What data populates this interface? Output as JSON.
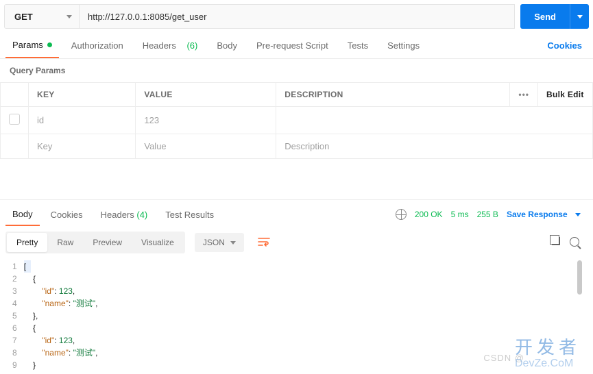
{
  "request": {
    "method": "GET",
    "url": "http://127.0.0.1:8085/get_user",
    "send_label": "Send"
  },
  "tabs": {
    "params": "Params",
    "auth": "Authorization",
    "headers": "Headers",
    "headers_count": "(6)",
    "body": "Body",
    "prereq": "Pre-request Script",
    "tests": "Tests",
    "settings": "Settings",
    "cookies": "Cookies"
  },
  "query_params": {
    "title": "Query Params",
    "headers": {
      "key": "KEY",
      "value": "VALUE",
      "desc": "DESCRIPTION",
      "bulk": "Bulk Edit",
      "opts": "ooo"
    },
    "rows": [
      {
        "key": "id",
        "value": "123",
        "desc": ""
      }
    ],
    "placeholder": {
      "key": "Key",
      "value": "Value",
      "desc": "Description"
    }
  },
  "response": {
    "tabs": {
      "body": "Body",
      "cookies": "Cookies",
      "headers": "Headers",
      "headers_count": "(4)",
      "tests": "Test Results"
    },
    "status_code": "200 OK",
    "time": "5 ms",
    "size": "255 B",
    "save": "Save Response"
  },
  "view": {
    "pretty": "Pretty",
    "raw": "Raw",
    "preview": "Preview",
    "visualize": "Visualize",
    "format": "JSON"
  },
  "code": {
    "lines": [
      {
        "n": 1,
        "text": "[",
        "hl": true
      },
      {
        "n": 2,
        "text": "    {"
      },
      {
        "n": 3,
        "k": "\"id\"",
        "v": "123",
        "vt": "num"
      },
      {
        "n": 4,
        "k": "\"name\"",
        "v": "\"测试\"",
        "vt": "str"
      },
      {
        "n": 5,
        "text": "    },"
      },
      {
        "n": 6,
        "text": "    {"
      },
      {
        "n": 7,
        "k": "\"id\"",
        "v": "123",
        "vt": "num"
      },
      {
        "n": 8,
        "k": "\"name\"",
        "v": "\"测试\"",
        "vt": "str"
      },
      {
        "n": 9,
        "text": "    }"
      }
    ]
  },
  "watermark": {
    "cn": "开发者",
    "en": "DevZe.CoM",
    "csdn": "CSDN @"
  }
}
